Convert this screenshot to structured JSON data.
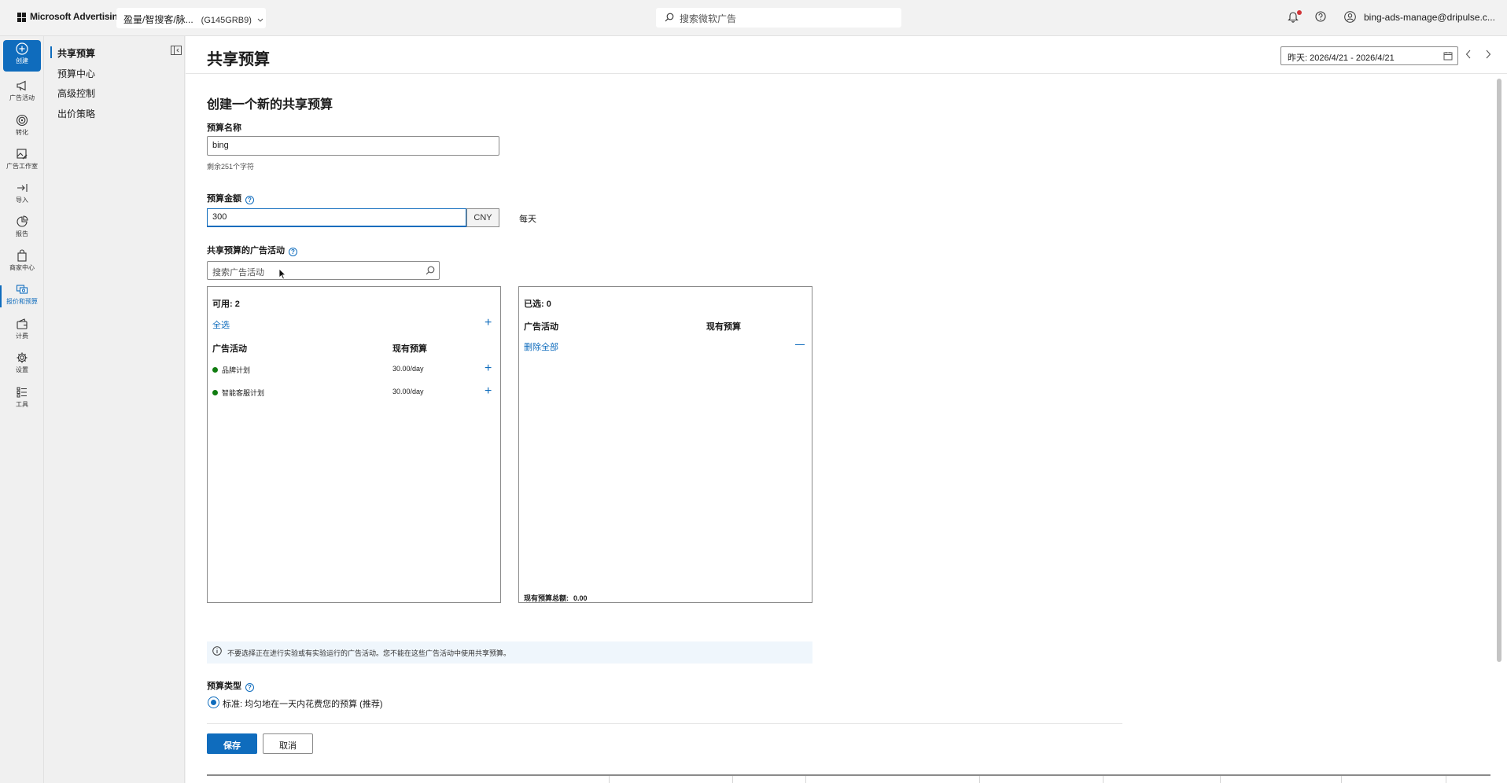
{
  "topbar": {
    "brand": "Microsoft Advertising",
    "account_name": "盈量/智搜客/脉...",
    "account_id": "(G145GRB9)",
    "search_placeholder": "搜索微软广告",
    "user": "bing-ads-manage@dripulse.c..."
  },
  "rail": {
    "items": [
      {
        "label": "创建",
        "icon": "plus-circle-icon"
      },
      {
        "label": "广告活动",
        "icon": "megaphone-icon"
      },
      {
        "label": "转化",
        "icon": "target-icon"
      },
      {
        "label": "广告工作室",
        "icon": "image-edit-icon"
      },
      {
        "label": "导入",
        "icon": "import-icon"
      },
      {
        "label": "报告",
        "icon": "report-icon"
      },
      {
        "label": "商家中心",
        "icon": "shopping-bag-icon"
      },
      {
        "label": "报价和预算",
        "icon": "budget-icon"
      },
      {
        "label": "计费",
        "icon": "wallet-icon"
      },
      {
        "label": "设置",
        "icon": "gear-icon"
      },
      {
        "label": "工具",
        "icon": "tools-icon"
      }
    ]
  },
  "subnav": {
    "items": [
      "共享预算",
      "预算中心",
      "高级控制",
      "出价策略"
    ]
  },
  "header": {
    "title": "共享预算",
    "date_range": "昨天: 2026/4/21 - 2026/4/21"
  },
  "form": {
    "section_title": "创建一个新的共享预算",
    "name_label": "预算名称",
    "name_value": "bing",
    "name_hint": "剩余251个字符",
    "amount_label": "预算金额",
    "amount_value": "300",
    "currency": "CNY",
    "period": "每天",
    "campaigns_label": "共享预算的广告活动",
    "campaign_search_placeholder": "搜索广告活动",
    "available": {
      "count_label": "可用:",
      "count": "2",
      "select_all": "全选",
      "col_campaign": "广告活动",
      "col_budget": "现有预算",
      "rows": [
        {
          "name": "品牌计划",
          "budget": "30.00/day",
          "status_color": "#107c10"
        },
        {
          "name": "智能客服计划",
          "budget": "30.00/day",
          "status_color": "#107c10"
        }
      ]
    },
    "selected": {
      "count_label": "已选:",
      "count": "0",
      "col_campaign": "广告活动",
      "col_budget": "现有预算",
      "remove_all": "删除全部",
      "total_label": "现有预算总额:",
      "total": "0.00"
    },
    "info": "不要选择正在进行实验或有实验运行的广告活动。您不能在这些广告活动中使用共享预算。",
    "type_label": "预算类型",
    "type_option": "标准: 均匀地在一天内花费您的预算 (推荐)",
    "save": "保存",
    "cancel": "取消"
  },
  "colors": {
    "accent": "#0f6cbd",
    "active_status": "#107c10",
    "notification": "#d13438"
  }
}
